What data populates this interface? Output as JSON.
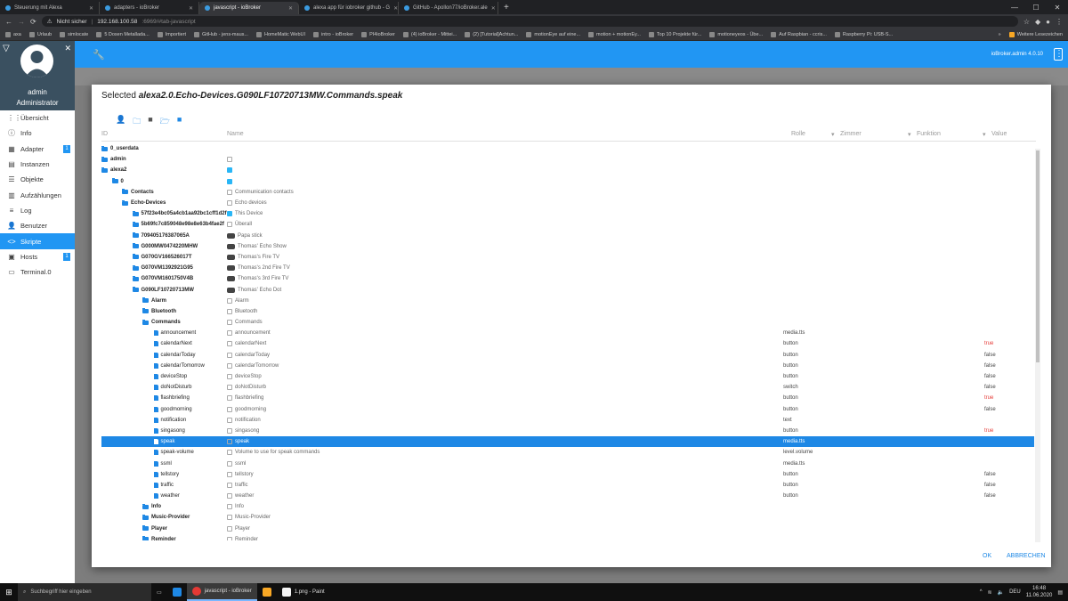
{
  "browser": {
    "tabs": [
      {
        "title": "Steuerung mit Alexa"
      },
      {
        "title": "adapters - ioBroker"
      },
      {
        "title": "javascript - ioBroker",
        "active": true
      },
      {
        "title": "alexa app für iobroker github - G"
      },
      {
        "title": "GitHub - Apollon77/ioBroker.ale"
      }
    ],
    "new_tab": "+",
    "security_label": "Nicht sicher",
    "url_host": "192.168.100.58",
    "url_rest": ":6969/#tab-javascript",
    "bookmarks": [
      "axa",
      "Urlaub",
      "simlocate",
      "5 Dosen Metallada...",
      "Importiert",
      "GitHub - jens-maus...",
      "HomeMatic WebUI",
      "intro - ioBroker",
      "PI4ioBroker",
      "(4) ioBroker - Mittei...",
      "(2) [Tutorial]Achtun...",
      "motionEye auf eine...",
      "motion + motionEy...",
      "Top 10 Projekte für...",
      "motioneyeos - Übe...",
      "Auf Raspbian - ccris...",
      "Raspberry Pi: USB-S..."
    ],
    "bookmarks_more": "»",
    "other_bookmarks": "Weitere Lesezeichen"
  },
  "sidebar": {
    "user_name": "admin",
    "user_role": "Administrator",
    "items": [
      {
        "label": "Übersicht",
        "icon": "grid-icon"
      },
      {
        "label": "Info",
        "icon": "info-icon"
      },
      {
        "label": "Adapter",
        "icon": "adapter-icon",
        "badge": "1"
      },
      {
        "label": "Instanzen",
        "icon": "instances-icon"
      },
      {
        "label": "Objekte",
        "icon": "objects-icon"
      },
      {
        "label": "Aufzählungen",
        "icon": "enums-icon"
      },
      {
        "label": "Log",
        "icon": "log-icon"
      },
      {
        "label": "Benutzer",
        "icon": "user-icon"
      },
      {
        "label": "Skripte",
        "icon": "code-icon",
        "active": true
      },
      {
        "label": "Hosts",
        "icon": "hosts-icon",
        "badge": "1"
      },
      {
        "label": "Terminal.0",
        "icon": "terminal-icon"
      }
    ]
  },
  "appbar": {
    "version": "ioBroker.admin 4.0.10"
  },
  "dialog": {
    "title_prefix": "Selected",
    "title_id": "alexa2.0.Echo-Devices.G090LF10720713MW.Commands.speak",
    "headers": {
      "id": "ID",
      "name": "Name",
      "role": "Rolle",
      "room": "Zimmer",
      "function": "Funktion",
      "value": "Value"
    },
    "ok": "OK",
    "cancel": "ABBRECHEN",
    "rows": [
      {
        "depth": 0,
        "type": "folder",
        "id": "0_userdata",
        "name": "",
        "name_icon": "",
        "role": "",
        "value": ""
      },
      {
        "depth": 0,
        "type": "folder",
        "id": "admin",
        "name": "",
        "name_icon": "admin-logo",
        "role": "",
        "value": ""
      },
      {
        "depth": 0,
        "type": "folder",
        "id": "alexa2",
        "name": "",
        "name_icon": "alexa-logo",
        "role": "",
        "value": ""
      },
      {
        "depth": 1,
        "type": "folder",
        "id": "0",
        "name": "",
        "name_icon": "alexa-logo",
        "role": "",
        "value": ""
      },
      {
        "depth": 2,
        "type": "folder",
        "id": "Contacts",
        "name": "Communication contacts",
        "name_icon": "state",
        "role": "",
        "value": ""
      },
      {
        "depth": 2,
        "type": "folder",
        "id": "Echo-Devices",
        "name": "Echo devices",
        "name_icon": "state",
        "role": "",
        "value": ""
      },
      {
        "depth": 3,
        "type": "folder",
        "id": "57f23e4bc05a4cb1aa92bc1cff1d2f",
        "name": "This Device",
        "name_icon": "alexa-logo",
        "role": "",
        "value": ""
      },
      {
        "depth": 3,
        "type": "folder",
        "id": "5b69fc7c859048e98e8e63b4fae2f",
        "name": "Überall",
        "name_icon": "state",
        "role": "",
        "value": ""
      },
      {
        "depth": 3,
        "type": "folder",
        "id": "709405176387065A",
        "name": "Papa stick",
        "name_icon": "device",
        "role": "",
        "value": ""
      },
      {
        "depth": 3,
        "type": "folder",
        "id": "G000MW0474220MHW",
        "name": "Thomas' Echo Show",
        "name_icon": "device",
        "role": "",
        "value": ""
      },
      {
        "depth": 3,
        "type": "folder",
        "id": "G070GV166526017T",
        "name": "Thomas's Fire TV",
        "name_icon": "device",
        "role": "",
        "value": ""
      },
      {
        "depth": 3,
        "type": "folder",
        "id": "G070VM1392921G95",
        "name": "Thomas's 2nd Fire TV",
        "name_icon": "device",
        "role": "",
        "value": ""
      },
      {
        "depth": 3,
        "type": "folder",
        "id": "G070VM1601750V4B",
        "name": "Thomas's 3rd Fire TV",
        "name_icon": "device",
        "role": "",
        "value": ""
      },
      {
        "depth": 3,
        "type": "folder",
        "id": "G090LF10720713MW",
        "name": "Thomas' Echo Dot",
        "name_icon": "device",
        "role": "",
        "value": ""
      },
      {
        "depth": 4,
        "type": "folder",
        "id": "Alarm",
        "name": "Alarm",
        "name_icon": "state",
        "role": "",
        "value": ""
      },
      {
        "depth": 4,
        "type": "folder",
        "id": "Bluetooth",
        "name": "Bluetooth",
        "name_icon": "state",
        "role": "",
        "value": ""
      },
      {
        "depth": 4,
        "type": "folder",
        "id": "Commands",
        "name": "Commands",
        "name_icon": "state",
        "role": "",
        "value": ""
      },
      {
        "depth": 5,
        "type": "state",
        "id": "announcement",
        "name": "announcement",
        "name_icon": "state",
        "role": "media.tts",
        "value": ""
      },
      {
        "depth": 5,
        "type": "state",
        "id": "calendarNext",
        "name": "calendarNext",
        "name_icon": "state",
        "role": "button",
        "value": "true"
      },
      {
        "depth": 5,
        "type": "state",
        "id": "calendarToday",
        "name": "calendarToday",
        "name_icon": "state",
        "role": "button",
        "value": "false"
      },
      {
        "depth": 5,
        "type": "state",
        "id": "calendarTomorrow",
        "name": "calendarTomorrow",
        "name_icon": "state",
        "role": "button",
        "value": "false"
      },
      {
        "depth": 5,
        "type": "state",
        "id": "deviceStop",
        "name": "deviceStop",
        "name_icon": "state",
        "role": "button",
        "value": "false"
      },
      {
        "depth": 5,
        "type": "state",
        "id": "doNotDisturb",
        "name": "doNotDisturb",
        "name_icon": "state",
        "role": "switch",
        "value": "false"
      },
      {
        "depth": 5,
        "type": "state",
        "id": "flashbriefing",
        "name": "flashbriefing",
        "name_icon": "state",
        "role": "button",
        "value": "true"
      },
      {
        "depth": 5,
        "type": "state",
        "id": "goodmorning",
        "name": "goodmorning",
        "name_icon": "state",
        "role": "button",
        "value": "false"
      },
      {
        "depth": 5,
        "type": "state",
        "id": "notification",
        "name": "notification",
        "name_icon": "state",
        "role": "text",
        "value": ""
      },
      {
        "depth": 5,
        "type": "state",
        "id": "singasong",
        "name": "singasong",
        "name_icon": "state",
        "role": "button",
        "value": "true"
      },
      {
        "depth": 5,
        "type": "state",
        "id": "speak",
        "name": "speak",
        "name_icon": "state",
        "role": "media.tts",
        "value": "",
        "selected": true
      },
      {
        "depth": 5,
        "type": "state",
        "id": "speak-volume",
        "name": "Volume to use for speak commands",
        "name_icon": "state",
        "role": "level.volume",
        "value": ""
      },
      {
        "depth": 5,
        "type": "state",
        "id": "ssml",
        "name": "ssml",
        "name_icon": "state",
        "role": "media.tts",
        "value": ""
      },
      {
        "depth": 5,
        "type": "state",
        "id": "tellstory",
        "name": "tellstory",
        "name_icon": "state",
        "role": "button",
        "value": "false"
      },
      {
        "depth": 5,
        "type": "state",
        "id": "traffic",
        "name": "traffic",
        "name_icon": "state",
        "role": "button",
        "value": "false"
      },
      {
        "depth": 5,
        "type": "state",
        "id": "weather",
        "name": "weather",
        "name_icon": "state",
        "role": "button",
        "value": "false"
      },
      {
        "depth": 4,
        "type": "folder",
        "id": "Info",
        "name": "Info",
        "name_icon": "state",
        "role": "",
        "value": ""
      },
      {
        "depth": 4,
        "type": "folder",
        "id": "Music-Provider",
        "name": "Music-Provider",
        "name_icon": "state",
        "role": "",
        "value": ""
      },
      {
        "depth": 4,
        "type": "folder",
        "id": "Player",
        "name": "Player",
        "name_icon": "state",
        "role": "",
        "value": ""
      },
      {
        "depth": 4,
        "type": "folder",
        "id": "Reminder",
        "name": "Reminder",
        "name_icon": "state",
        "role": "",
        "value": ""
      }
    ]
  },
  "taskbar": {
    "search_placeholder": "Suchbegriff hier eingeben",
    "apps": [
      {
        "label": "javascript - ioBroker",
        "active": true
      },
      {
        "label": "1.png - Paint",
        "active": false
      }
    ],
    "time": "16:48",
    "date": "11.06.2020"
  },
  "colors": {
    "accent": "#2196f3",
    "selected_row": "#1e88e5",
    "true_value": "#e53935"
  }
}
